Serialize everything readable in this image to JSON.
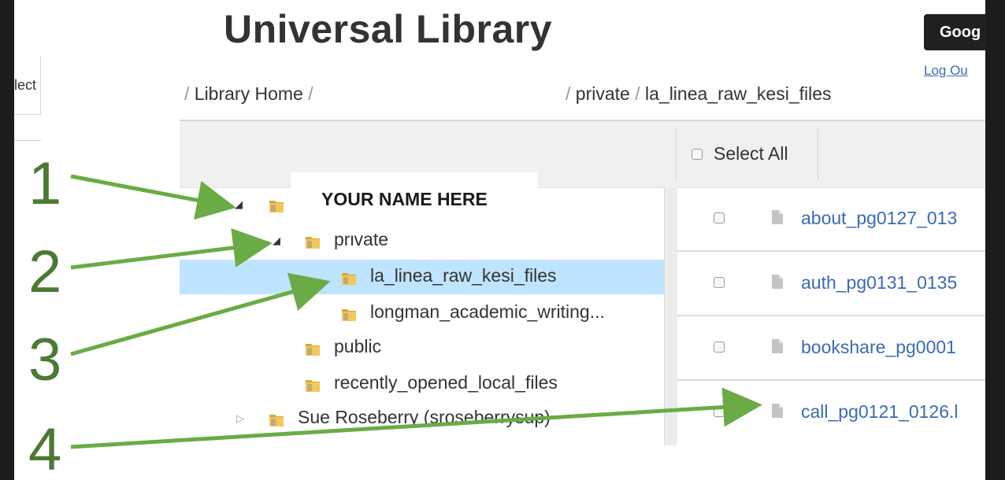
{
  "header": {
    "title": "Universal Library",
    "google_button": "Goog",
    "logout": "Log Ou"
  },
  "left_fragment": "lect",
  "breadcrumb": {
    "sep": "/",
    "home": "Library Home",
    "partial": "/ ",
    "private": "private",
    "current": "la_linea_raw_kesi_files"
  },
  "toolbar": {
    "select_all": "Select All"
  },
  "tree": {
    "name_overlay": "YOUR NAME HERE",
    "items": [
      {
        "label": "",
        "toggle": "◢"
      },
      {
        "label": "private",
        "toggle": "◢"
      },
      {
        "label": "la_linea_raw_kesi_files",
        "toggle": ""
      },
      {
        "label": "longman_academic_writing...",
        "toggle": ""
      },
      {
        "label": "public",
        "toggle": ""
      },
      {
        "label": "recently_opened_local_files",
        "toggle": ""
      },
      {
        "label": "Sue Roseberry (sroseberrysup)",
        "toggle": "▷"
      }
    ]
  },
  "files": [
    {
      "name": "about_pg0127_013"
    },
    {
      "name": "auth_pg0131_0135"
    },
    {
      "name": "bookshare_pg0001"
    },
    {
      "name": "call_pg0121_0126.l"
    }
  ],
  "annotations": {
    "numbers": [
      "1",
      "2",
      "3",
      "4"
    ],
    "arrow_color": "#6aab45",
    "number_color": "#4a7a34"
  },
  "colors": {
    "selected_row": "#bfe4ff",
    "link": "#3a6bb5",
    "folder": "#d9a53a"
  }
}
